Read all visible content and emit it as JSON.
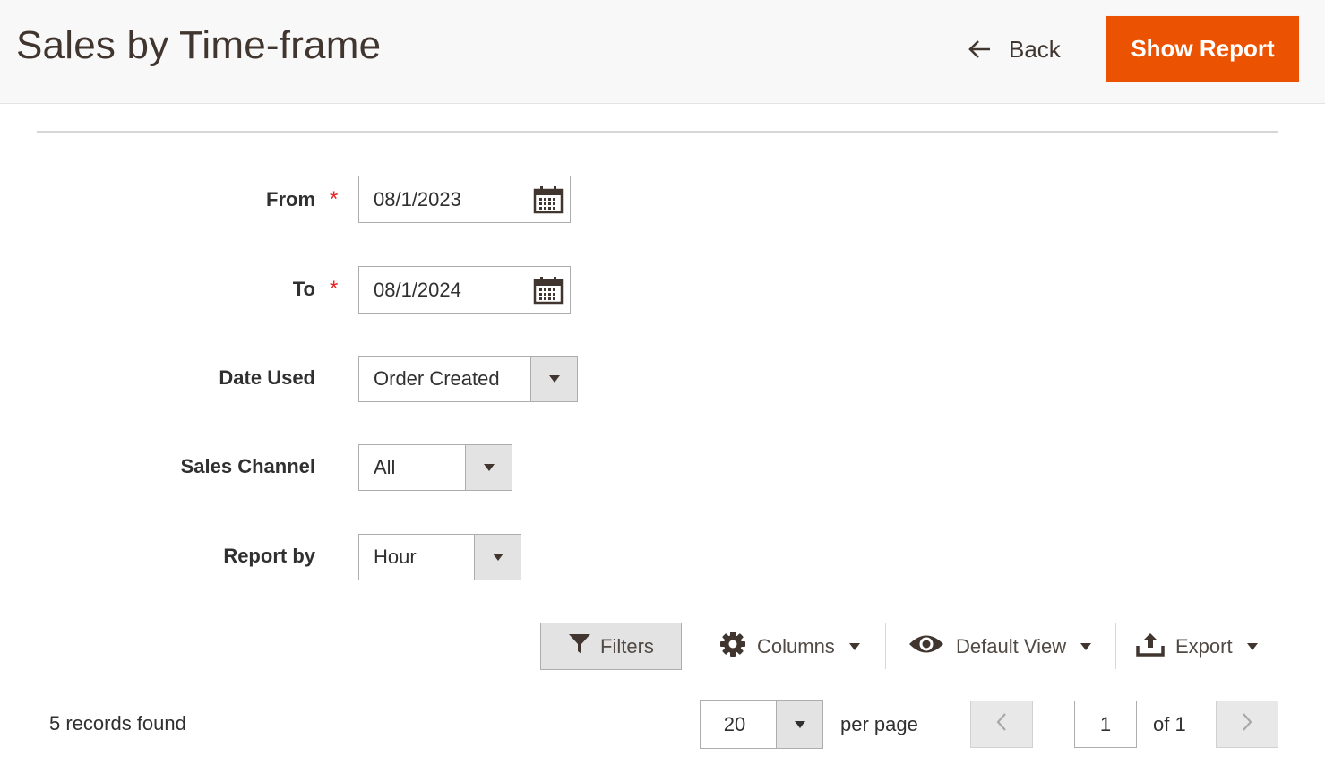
{
  "header": {
    "title": "Sales by Time-frame",
    "back_label": "Back",
    "show_report_label": "Show Report"
  },
  "form": {
    "from": {
      "label": "From",
      "required_mark": "*",
      "value": "08/1/2023",
      "icon": "calendar-icon"
    },
    "to": {
      "label": "To",
      "required_mark": "*",
      "value": "08/1/2024",
      "icon": "calendar-icon"
    },
    "date_used": {
      "label": "Date Used",
      "value": "Order Created"
    },
    "sales_channel": {
      "label": "Sales Channel",
      "value": "All"
    },
    "report_by": {
      "label": "Report by",
      "value": "Hour"
    }
  },
  "toolbar": {
    "filters_label": "Filters",
    "columns_label": "Columns",
    "default_view_label": "Default View",
    "export_label": "Export"
  },
  "pagination": {
    "records_found": "5 records found",
    "per_page_value": "20",
    "per_page_label": "per page",
    "current_page": "1",
    "of_label": "of 1"
  },
  "colors": {
    "accent": "#eb5202",
    "header_bg": "#f8f8f8",
    "required": "#e22626",
    "text": "#303030"
  }
}
